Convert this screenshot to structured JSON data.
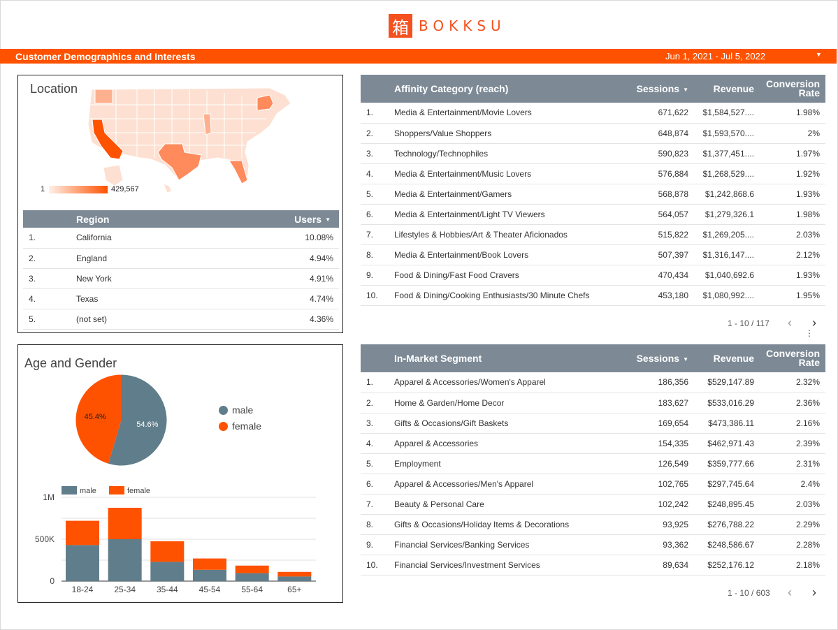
{
  "brand": {
    "glyph": "箱",
    "name": "BOKKSU"
  },
  "header": {
    "title": "Customer Demographics and Interests",
    "date_range": "Jun 1, 2021 - Jul 5, 2022",
    "dropdown_icon": "caret-down-icon"
  },
  "colors": {
    "accent": "#ff5200",
    "male": "#607d8b",
    "female": "#ff5200",
    "table_header": "#7d8a96"
  },
  "location": {
    "title": "Location",
    "legend_min": "1",
    "legend_max": "429,567",
    "table": {
      "headers": {
        "region": "Region",
        "users": "Users"
      },
      "rows": [
        {
          "n": "1.",
          "region": "California",
          "users": "10.08%"
        },
        {
          "n": "2.",
          "region": "England",
          "users": "4.94%"
        },
        {
          "n": "3.",
          "region": "New York",
          "users": "4.91%"
        },
        {
          "n": "4.",
          "region": "Texas",
          "users": "4.74%"
        },
        {
          "n": "5.",
          "region": "(not set)",
          "users": "4.36%"
        }
      ]
    }
  },
  "affinity": {
    "headers": {
      "category": "Affinity Category (reach)",
      "sessions": "Sessions",
      "revenue": "Revenue",
      "conversion_1": "Conversion",
      "conversion_2": "Rate"
    },
    "rows": [
      {
        "n": "1.",
        "category": "Media & Entertainment/Movie Lovers",
        "sessions": "671,622",
        "revenue": "$1,584,527....",
        "rate": "1.98%"
      },
      {
        "n": "2.",
        "category": "Shoppers/Value Shoppers",
        "sessions": "648,874",
        "revenue": "$1,593,570....",
        "rate": "2%"
      },
      {
        "n": "3.",
        "category": "Technology/Technophiles",
        "sessions": "590,823",
        "revenue": "$1,377,451....",
        "rate": "1.97%"
      },
      {
        "n": "4.",
        "category": "Media & Entertainment/Music Lovers",
        "sessions": "576,884",
        "revenue": "$1,268,529....",
        "rate": "1.92%"
      },
      {
        "n": "5.",
        "category": "Media & Entertainment/Gamers",
        "sessions": "568,878",
        "revenue": "$1,242,868.6",
        "rate": "1.93%"
      },
      {
        "n": "6.",
        "category": "Media & Entertainment/Light TV Viewers",
        "sessions": "564,057",
        "revenue": "$1,279,326.1",
        "rate": "1.98%"
      },
      {
        "n": "7.",
        "category": "Lifestyles & Hobbies/Art & Theater Aficionados",
        "sessions": "515,822",
        "revenue": "$1,269,205....",
        "rate": "2.03%"
      },
      {
        "n": "8.",
        "category": "Media & Entertainment/Book Lovers",
        "sessions": "507,397",
        "revenue": "$1,316,147....",
        "rate": "2.12%"
      },
      {
        "n": "9.",
        "category": "Food & Dining/Fast Food Cravers",
        "sessions": "470,434",
        "revenue": "$1,040,692.6",
        "rate": "1.93%"
      },
      {
        "n": "10.",
        "category": "Food & Dining/Cooking Enthusiasts/30 Minute Chefs",
        "sessions": "453,180",
        "revenue": "$1,080,992....",
        "rate": "1.95%"
      }
    ],
    "pager": "1 - 10 / 117"
  },
  "market": {
    "headers": {
      "segment": "In-Market Segment",
      "sessions": "Sessions",
      "revenue": "Revenue",
      "conversion_1": "Conversion",
      "conversion_2": "Rate"
    },
    "rows": [
      {
        "n": "1.",
        "segment": "Apparel & Accessories/Women's Apparel",
        "sessions": "186,356",
        "revenue": "$529,147.89",
        "rate": "2.32%"
      },
      {
        "n": "2.",
        "segment": "Home & Garden/Home Decor",
        "sessions": "183,627",
        "revenue": "$533,016.29",
        "rate": "2.36%"
      },
      {
        "n": "3.",
        "segment": "Gifts & Occasions/Gift Baskets",
        "sessions": "169,654",
        "revenue": "$473,386.11",
        "rate": "2.16%"
      },
      {
        "n": "4.",
        "segment": "Apparel & Accessories",
        "sessions": "154,335",
        "revenue": "$462,971.43",
        "rate": "2.39%"
      },
      {
        "n": "5.",
        "segment": "Employment",
        "sessions": "126,549",
        "revenue": "$359,777.66",
        "rate": "2.31%"
      },
      {
        "n": "6.",
        "segment": "Apparel & Accessories/Men's Apparel",
        "sessions": "102,765",
        "revenue": "$297,745.64",
        "rate": "2.4%"
      },
      {
        "n": "7.",
        "segment": "Beauty & Personal Care",
        "sessions": "102,242",
        "revenue": "$248,895.45",
        "rate": "2.03%"
      },
      {
        "n": "8.",
        "segment": "Gifts & Occasions/Holiday Items & Decorations",
        "sessions": "93,925",
        "revenue": "$276,788.22",
        "rate": "2.29%"
      },
      {
        "n": "9.",
        "segment": "Financial Services/Banking Services",
        "sessions": "93,362",
        "revenue": "$248,586.67",
        "rate": "2.28%"
      },
      {
        "n": "10.",
        "segment": "Financial Services/Investment Services",
        "sessions": "89,634",
        "revenue": "$252,176.12",
        "rate": "2.18%"
      }
    ],
    "pager": "1 - 10 / 603"
  },
  "age_gender": {
    "title": "Age and Gender",
    "legend": {
      "male": "male",
      "female": "female"
    }
  },
  "chart_data": [
    {
      "type": "pie",
      "labels": [
        "male",
        "female"
      ],
      "values": [
        54.6,
        45.4
      ],
      "value_labels": [
        "54.6%",
        "45.4%"
      ],
      "colors": [
        "#607d8b",
        "#ff5200"
      ],
      "legend": "right"
    },
    {
      "type": "bar",
      "stacked": true,
      "categories": [
        "18-24",
        "25-34",
        "35-44",
        "45-54",
        "55-64",
        "65+"
      ],
      "series": [
        {
          "name": "male",
          "values": [
            430000,
            500000,
            230000,
            135000,
            95000,
            55000
          ],
          "color": "#607d8b"
        },
        {
          "name": "female",
          "values": [
            290000,
            375000,
            245000,
            135000,
            90000,
            55000
          ],
          "color": "#ff5200"
        }
      ],
      "ylim": [
        0,
        1000000
      ],
      "yticks": [
        0,
        500000,
        1000000
      ],
      "ytick_labels": [
        "0",
        "500K",
        "1M"
      ],
      "grid": true,
      "legend": "top-left"
    }
  ]
}
